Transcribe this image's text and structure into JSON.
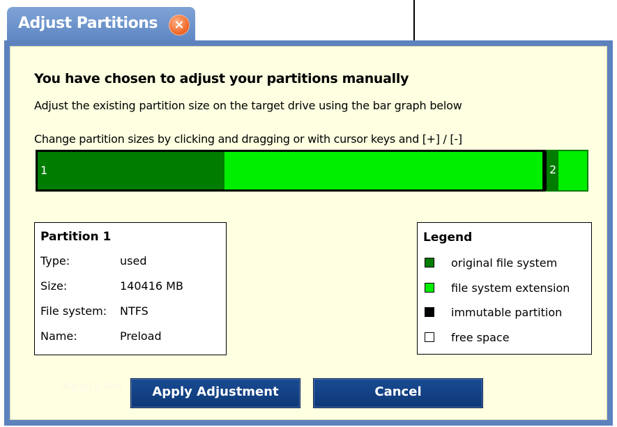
{
  "tab": {
    "title": "Adjust Partitions",
    "close_glyph": "×"
  },
  "header": {
    "title": "You have chosen to adjust your partitions manually",
    "subtitle": "Adjust the existing partition size on the target drive using the bar graph below"
  },
  "bar": {
    "instruction": "Change partition sizes by clicking and dragging or with cursor keys and [+] / [-]",
    "partitions": [
      {
        "label": "1",
        "original_fraction": 0.37,
        "extension_fraction": 0.63
      },
      {
        "label": "2",
        "original_fraction": 0.3,
        "extension_fraction": 0.7
      }
    ]
  },
  "partition_info": {
    "title": "Partition 1",
    "rows": [
      {
        "key": "Type:",
        "value": "used"
      },
      {
        "key": "Size:",
        "value": "140416 MB"
      },
      {
        "key": "File system:",
        "value": "NTFS"
      },
      {
        "key": "Name:",
        "value": "Preload"
      }
    ]
  },
  "legend": {
    "title": "Legend",
    "items": [
      {
        "label": "original file system",
        "color": "#007c00"
      },
      {
        "label": "file system extension",
        "color": "#00ee00"
      },
      {
        "label": "immutable partition",
        "color": "#000000"
      },
      {
        "label": "free space",
        "color": "#ffffff"
      }
    ]
  },
  "buttons": {
    "ghost_label": "Apply Ad",
    "apply_label": "Apply Adjustment",
    "cancel_label": "Cancel"
  },
  "colors": {
    "tab_blue": "#6f95cc",
    "panel_background": "#ffffe1",
    "button_blue": "#123f82"
  }
}
